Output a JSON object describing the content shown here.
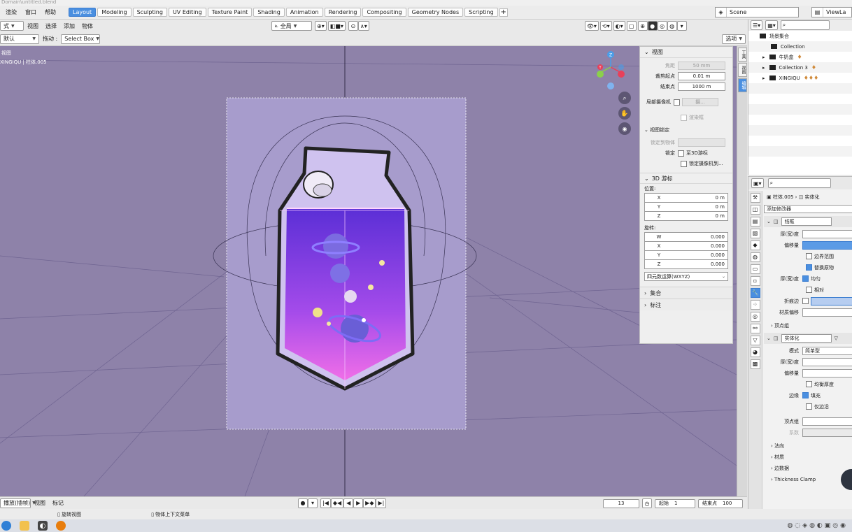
{
  "window": {
    "title": "Domain\\untitled.blend"
  },
  "menu": [
    "渲染",
    "窗口",
    "帮助"
  ],
  "workspaces": [
    {
      "label": "Layout",
      "active": true
    },
    {
      "label": "Modeling"
    },
    {
      "label": "Sculpting"
    },
    {
      "label": "UV Editing"
    },
    {
      "label": "Texture Paint"
    },
    {
      "label": "Shading"
    },
    {
      "label": "Animation"
    },
    {
      "label": "Rendering"
    },
    {
      "label": "Compositing"
    },
    {
      "label": "Geometry Nodes"
    },
    {
      "label": "Scripting"
    }
  ],
  "scene": {
    "label": "Scene"
  },
  "viewlayer": {
    "label": "ViewLa"
  },
  "viewport_header": {
    "mode": "式",
    "menus": [
      "视图",
      "选择",
      "添加",
      "物体"
    ],
    "orientation": "全局",
    "orientation_label": "默认",
    "drag_label": "拖动 :",
    "select_mode": "Select Box",
    "options_label": "选项"
  },
  "viewport": {
    "info_line1": "视图",
    "info_line2": "XINGIQU | 柱体.005",
    "background": "#8e82a9"
  },
  "side_tabs": [
    "工具",
    "视图",
    "编辑"
  ],
  "npanel": {
    "view_section": "视图",
    "focal_label": "焦距",
    "focal_value": "50 mm",
    "clip_start_label": "裁剪起点",
    "clip_start_value": "0.01 m",
    "clip_end_label": "结束点",
    "clip_end_value": "1000 m",
    "local_camera_label": "局部摄像机",
    "local_camera_value": "摄...",
    "render_region_label": "渲染框",
    "view_lock_section": "视图锁定",
    "lock_to_object_label": "锁定到物体",
    "lock_label": "锁定",
    "lock_3d_cursor": "至3D游标",
    "lock_camera": "锁定摄像机到...",
    "cursor_section": "3D 游标",
    "location_label": "位置:",
    "location": [
      {
        "axis": "X",
        "value": "0 m"
      },
      {
        "axis": "Y",
        "value": "0 m"
      },
      {
        "axis": "Z",
        "value": "0 m"
      }
    ],
    "rotation_label": "旋转:",
    "rotation": [
      {
        "axis": "W",
        "value": "0.000"
      },
      {
        "axis": "X",
        "value": "0.000"
      },
      {
        "axis": "Y",
        "value": "0.000"
      },
      {
        "axis": "Z",
        "value": "0.000"
      }
    ],
    "rotation_mode": "四元数运算(WXYZ)",
    "collection_section": "集合",
    "annotation_section": "标注"
  },
  "outliner": {
    "rows": [
      {
        "label": "场景集合",
        "indent": 0,
        "badge": ""
      },
      {
        "label": "Collection",
        "indent": 1,
        "badge": ""
      },
      {
        "label": "牛奶盒",
        "indent": 1,
        "badge": "♦"
      },
      {
        "label": "Collection 3",
        "indent": 1,
        "badge": "♦"
      },
      {
        "label": "XINGIQU",
        "indent": 1,
        "badge": "♦♦♦"
      }
    ]
  },
  "properties": {
    "breadcrumb_object": "柱体.005",
    "breadcrumb_modifier": "实体化",
    "add_modifier": "添加修改器",
    "mod1_name": "线框",
    "thickness_label": "厚(宽)度",
    "offset_label": "偏移量",
    "boundary_label": "边界范围",
    "replace_label": "替换原物",
    "even_label": "均匀",
    "relative_label": "相对",
    "crease_label": "折痕边",
    "material_offset_label": "材质偏移",
    "vertex_group": "顶点组",
    "mod2_name": "实体化",
    "mode_label": "模式",
    "mode_value": "简单型",
    "even_thickness": "均衡厚度",
    "rim_label": "边缘",
    "fill_label": "填充",
    "only_rim_label": "仅边沿",
    "vg_label": "顶点组",
    "factor_label": "系数",
    "normals": "法向",
    "materials": "材质",
    "edge_data": "边数据",
    "thickness_clamp": "Thickness Clamp"
  },
  "timeline": {
    "mode": "播放(插帧)",
    "menus": [
      "视图",
      "标记"
    ],
    "current_frame": "13",
    "start_label": "起始",
    "start_value": "1",
    "end_label": "结束点",
    "end_value": "100"
  },
  "status": {
    "rotate": "旋转视图",
    "context": "物体上下文菜单"
  }
}
